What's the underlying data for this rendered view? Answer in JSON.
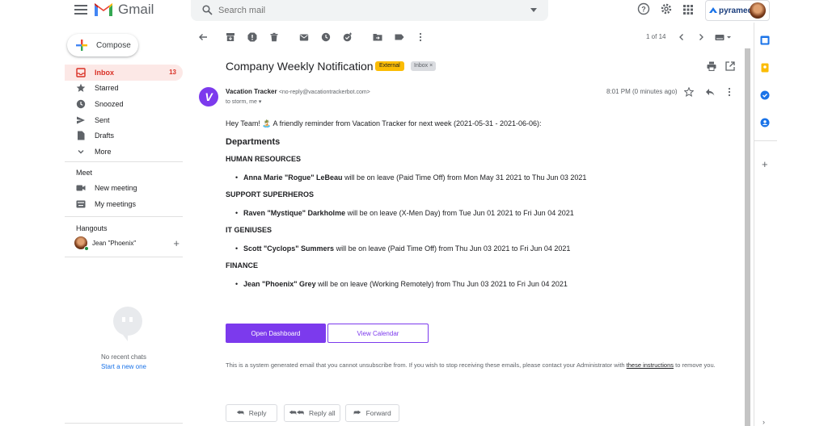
{
  "app": {
    "name": "Gmail"
  },
  "search": {
    "placeholder": "Search mail"
  },
  "account": {
    "brand": "pyrameda"
  },
  "sidebar": {
    "compose_label": "Compose",
    "items": [
      {
        "label": "Inbox",
        "count": "13",
        "icon": "inbox-icon"
      },
      {
        "label": "Starred",
        "count": "",
        "icon": "star-icon"
      },
      {
        "label": "Snoozed",
        "count": "",
        "icon": "clock-icon"
      },
      {
        "label": "Sent",
        "count": "",
        "icon": "send-icon"
      },
      {
        "label": "Drafts",
        "count": "",
        "icon": "draft-icon"
      },
      {
        "label": "More",
        "count": "",
        "icon": "chevron-down-icon"
      }
    ],
    "meet": {
      "title": "Meet",
      "new_meeting": "New meeting",
      "my_meetings": "My meetings"
    },
    "hangouts": {
      "title": "Hangouts",
      "user": "Jean \"Phoenix\"",
      "no_chats": "No recent chats",
      "start_new": "Start a new one"
    }
  },
  "toolbar": {
    "pager": "1 of 14"
  },
  "email": {
    "subject": "Company Weekly Notification",
    "labels": {
      "external": "External",
      "inbox": "Inbox"
    },
    "sender_initial": "V",
    "sender_name": "Vacation Tracker",
    "sender_email": "<no-reply@vacationtrackerbot.com>",
    "recipients": "to storm, me",
    "time": "8:01 PM (0 minutes ago)",
    "greeting": "Hey Team! 🏝️ A friendly reminder from Vacation Tracker for next week (2021-05-31 - 2021-06-06):",
    "heading": "Departments",
    "departments": [
      {
        "name": "HUMAN RESOURCES",
        "person": "Anna Marie \"Rogue\" LeBeau",
        "detail": " will be on leave (Paid Time Off) from Mon May 31 2021 to Thu Jun 03 2021"
      },
      {
        "name": "SUPPORT SUPERHEROS",
        "person": "Raven \"Mystique\" Darkholme",
        "detail": " will be on leave (X-Men Day) from Tue Jun 01 2021 to Fri Jun 04 2021"
      },
      {
        "name": "IT GENIUSES",
        "person": "Scott \"Cyclops\" Summers",
        "detail": " will be on leave (Paid Time Off) from Thu Jun 03 2021 to Fri Jun 04 2021"
      },
      {
        "name": "FINANCE",
        "person": "Jean \"Phoenix\" Grey",
        "detail": " will be on leave (Working Remotely) from Thu Jun 03 2021 to Fri Jun 04 2021"
      }
    ],
    "primary_button": "Open Dashboard",
    "secondary_button": "View Calendar",
    "disclaimer_pre": "This is a system generated email that you cannot unsubscribe from. If you wish to stop receiving these emails, please contact your Administrator with ",
    "disclaimer_link": "these instructions",
    "disclaimer_post": " to remove you."
  },
  "actions": {
    "reply": "Reply",
    "reply_all": "Reply all",
    "forward": "Forward"
  },
  "colors": {
    "accent": "#7c3aed",
    "gmail_red": "#d93025",
    "inbox_active_bg": "#fce8e6",
    "external_badge": "#fbbc04"
  }
}
